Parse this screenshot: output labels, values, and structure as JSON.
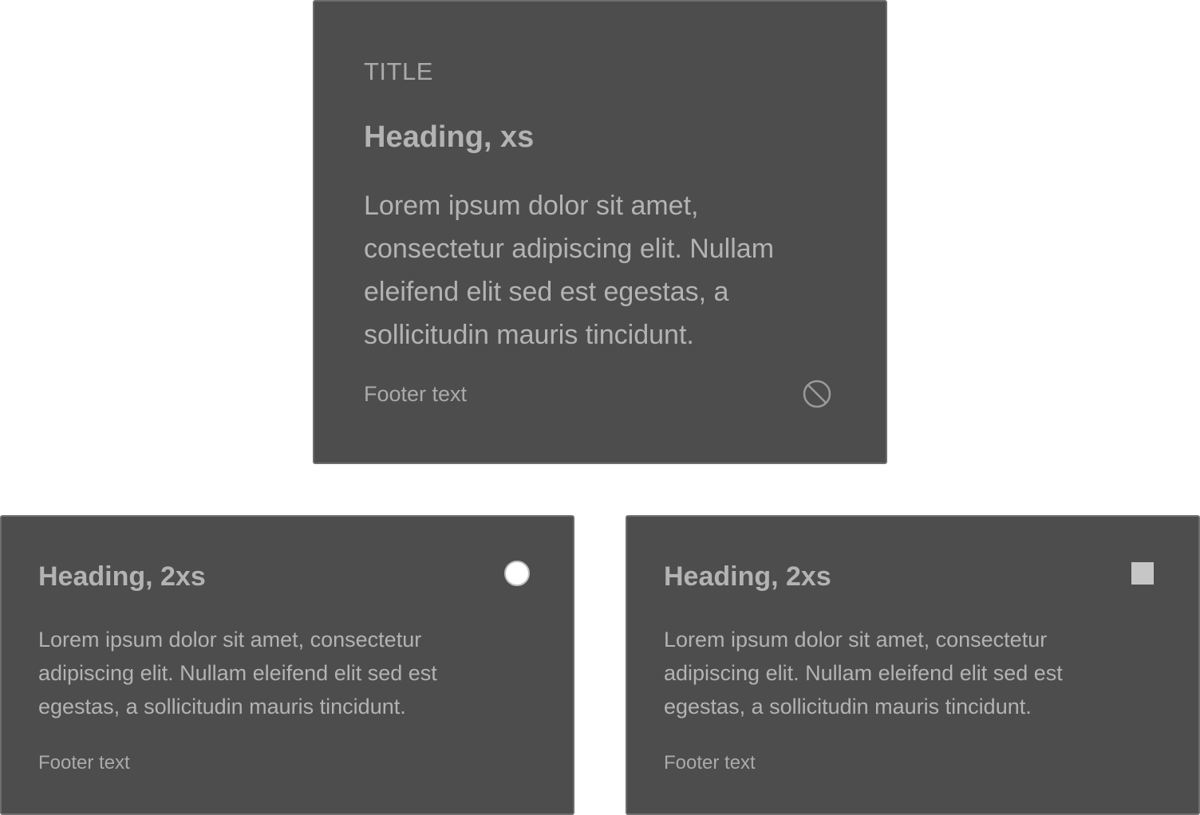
{
  "cards": {
    "top": {
      "eyebrow": "TITLE",
      "heading": "Heading, xs",
      "body": "Lorem ipsum dolor sit amet, consectetur adipiscing elit. Nullam eleifend elit sed est egestas, a sollicitudin mauris tincidunt.",
      "footer": "Footer text",
      "action_icon": "block-icon"
    },
    "left": {
      "heading": "Heading, 2xs",
      "body": "Lorem ipsum dolor sit amet, consectetur adipiscing elit. Nullam eleifend elit sed est egestas, a sollicitudin mauris tincidunt.",
      "footer": "Footer text",
      "control": "radio",
      "selected": false
    },
    "right": {
      "heading": "Heading, 2xs",
      "body": "Lorem ipsum dolor sit amet, consectetur adipiscing elit. Nullam eleifend elit sed est egestas, a sollicitudin mauris tincidunt.",
      "footer": "Footer text",
      "control": "checkbox",
      "checked": false
    }
  },
  "colors": {
    "page_background": "#ffffff",
    "card_background": "#4d4d4d",
    "card_border": "#6e6e6e",
    "text": "#b3b3b3",
    "muted_text": "#aaaaaa"
  }
}
